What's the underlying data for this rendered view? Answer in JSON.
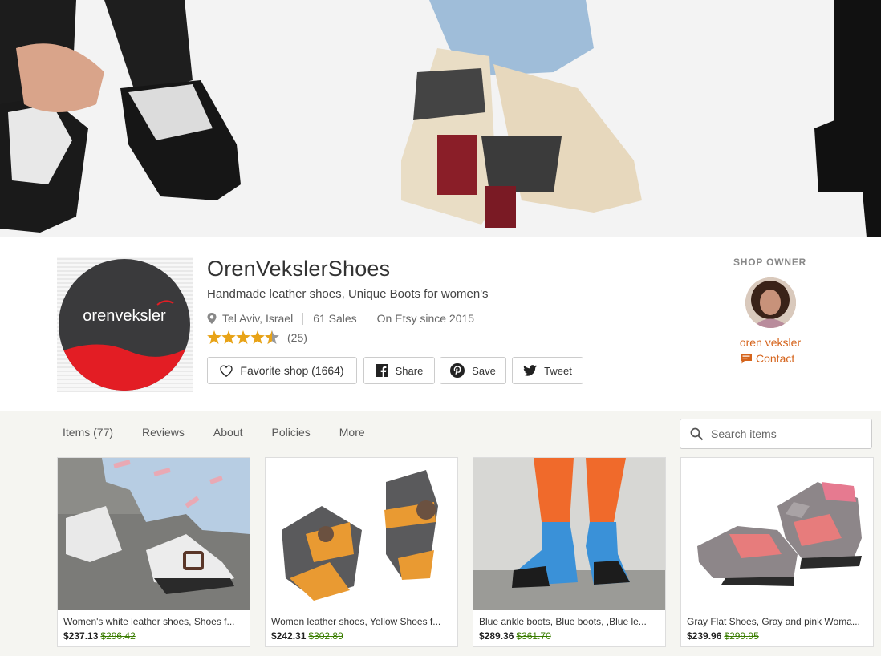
{
  "banner": {
    "alt": "Shop banner with handmade leather shoes"
  },
  "shop": {
    "name": "OrenVekslerShoes",
    "tagline": "Handmade leather shoes, Unique Boots for women's",
    "location": "Tel Aviv, Israel",
    "sales": "61 Sales",
    "since": "On Etsy since 2015",
    "rating": 4.5,
    "review_count": "(25)",
    "logo_text": "orenveksler"
  },
  "actions": {
    "favorite": "Favorite shop (1664)",
    "share": "Share",
    "save": "Save",
    "tweet": "Tweet"
  },
  "owner": {
    "label": "SHOP OWNER",
    "name": "oren veksler",
    "contact": "Contact"
  },
  "tabs": [
    {
      "label": "Items (77)"
    },
    {
      "label": "Reviews"
    },
    {
      "label": "About"
    },
    {
      "label": "Policies"
    },
    {
      "label": "More"
    }
  ],
  "search": {
    "placeholder": "Search items"
  },
  "listings": [
    {
      "title": "Women's white leather shoes, Shoes f...",
      "price": "$237.13",
      "old_price": "$296.42"
    },
    {
      "title": "Women leather shoes, Yellow Shoes f...",
      "price": "$242.31",
      "old_price": "$302.89"
    },
    {
      "title": "Blue ankle boots, Blue boots, ,Blue le...",
      "price": "$289.36",
      "old_price": "$361.70"
    },
    {
      "title": "Gray Flat Shoes, Gray and pink Woma...",
      "price": "$239.96",
      "old_price": "$299.95"
    }
  ],
  "colors": {
    "accent": "#d5641c",
    "sale": "#3a7d00",
    "star": "#e8a317"
  }
}
